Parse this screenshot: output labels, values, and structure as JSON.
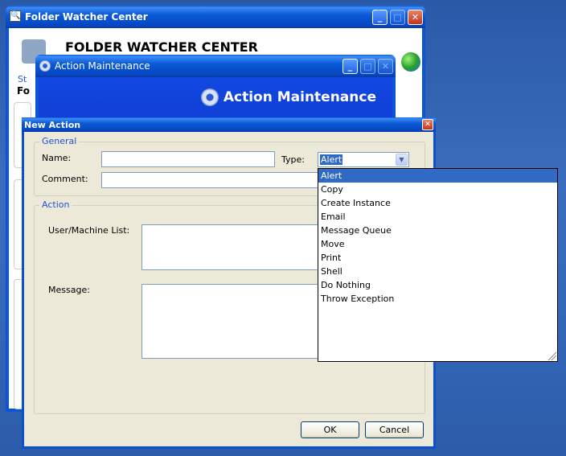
{
  "folder_watcher": {
    "title": "Folder Watcher Center",
    "heading": "FOLDER WATCHER CENTER",
    "section_label_partial": "St",
    "field_partial": "Fo"
  },
  "action_maintenance": {
    "title": "Action Maintenance",
    "banner": "Action Maintenance"
  },
  "new_action": {
    "title": "New Action",
    "general_group": "General",
    "name_label": "Name:",
    "name_value": "",
    "type_label": "Type:",
    "type_value": "Alert",
    "comment_label": "Comment:",
    "comment_value": "",
    "action_group": "Action",
    "user_list_label": "User/Machine List:",
    "message_label": "Message:",
    "ok_label": "OK",
    "cancel_label": "Cancel"
  },
  "type_options": [
    "Alert",
    "Copy",
    "Create Instance",
    "Email",
    "Message Queue",
    "Move",
    "Print",
    "Shell",
    "Do Nothing",
    "Throw Exception"
  ],
  "selected_option_index": 0,
  "colors": {
    "titlebar": "#0b55d4",
    "dialog_bg": "#ece9d8",
    "selection": "#316ac5",
    "group_label": "#1f50d6"
  },
  "icons": [
    "magnifier-icon",
    "minimize-icon",
    "maximize-icon",
    "close-icon",
    "gear-icon",
    "globe-icon",
    "dropdown-arrow-icon",
    "resize-grip-icon"
  ]
}
